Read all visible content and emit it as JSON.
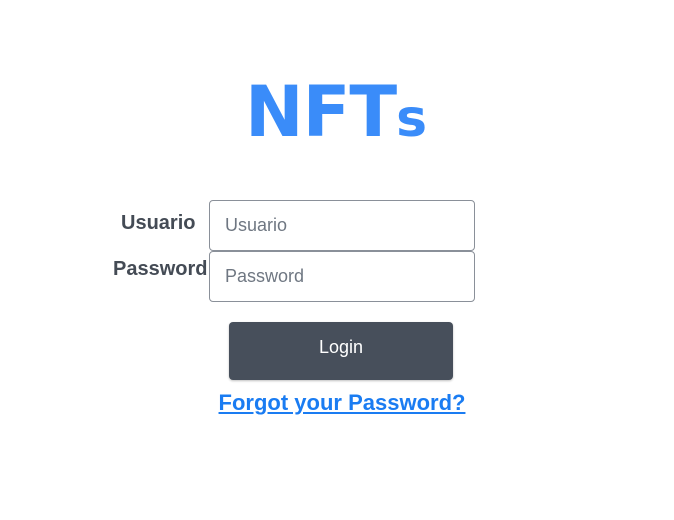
{
  "logo": {
    "text_main": "NFT",
    "text_small": "s",
    "color": "#3a8cf9"
  },
  "form": {
    "username_label": "Usuario",
    "username_placeholder": "Usuario",
    "username_value": "",
    "password_label": "Password",
    "password_placeholder": "Password",
    "password_value": "",
    "login_button": "Login",
    "forgot_link": "Forgot your Password?"
  },
  "colors": {
    "button": "#474f5b",
    "link": "#1a7cf2",
    "label": "#444b55"
  }
}
